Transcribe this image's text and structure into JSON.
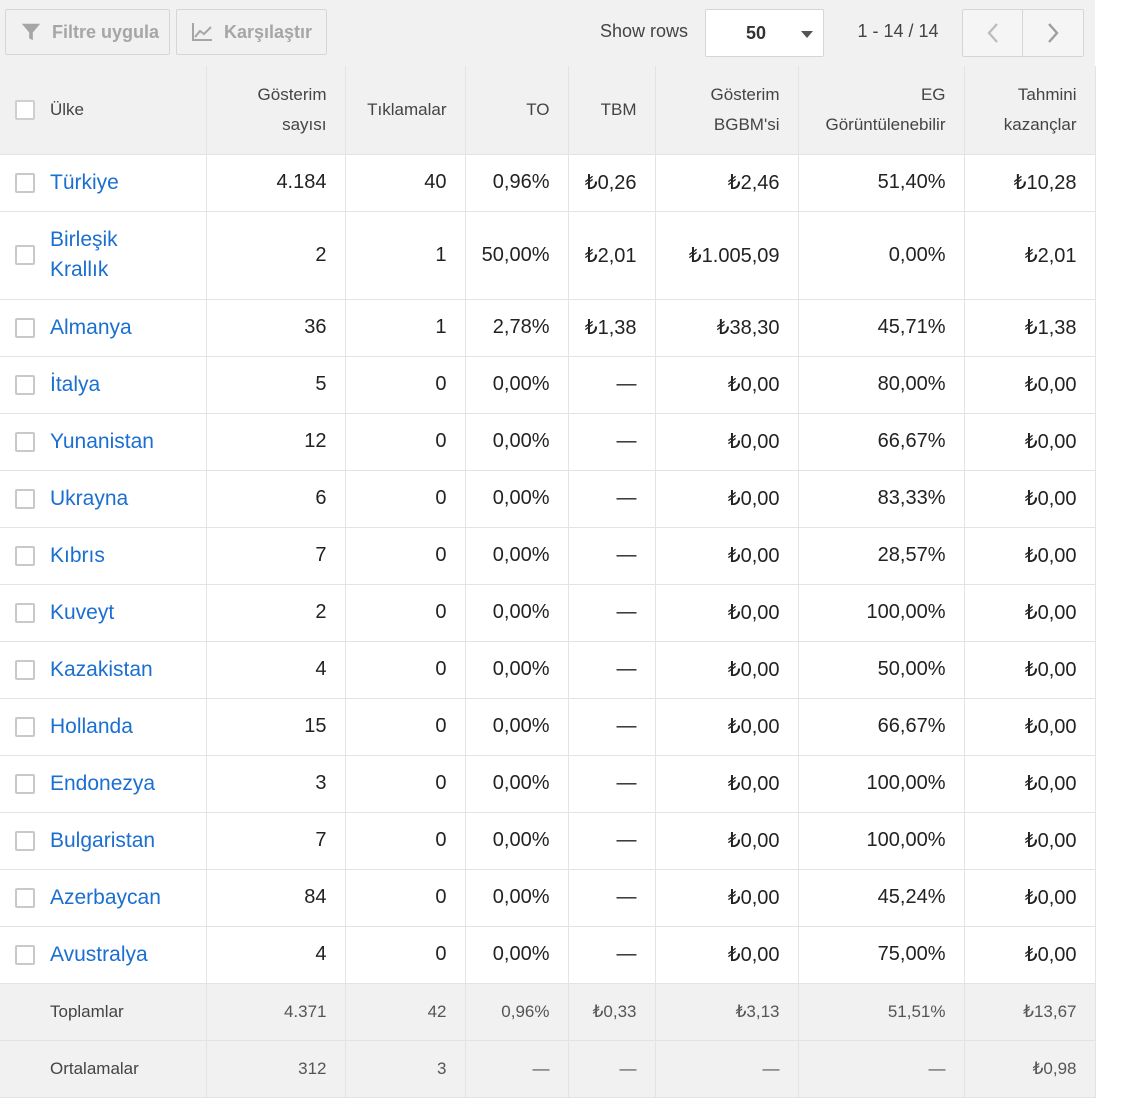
{
  "toolbar": {
    "filter_label": "Filtre uygula",
    "compare_label": "Karşılaştır",
    "show_rows_label": "Show rows",
    "rows_value": "50",
    "range_text": "1 - 14 / 14"
  },
  "columns": {
    "country": "Ülke",
    "impressions_1": "Gösterim",
    "impressions_2": "sayısı",
    "clicks": "Tıklamalar",
    "ctr": "TO",
    "cpc": "TBM",
    "rpm_1": "Gösterim",
    "rpm_2": "BGBM'si",
    "viewable_1": "EG",
    "viewable_2": "Görüntülenebilir",
    "earnings_1": "Tahmini",
    "earnings_2": "kazançlar"
  },
  "rows": [
    {
      "country": "Türkiye",
      "impressions": "4.184",
      "clicks": "40",
      "ctr": "0,96%",
      "cpc": "₺0,26",
      "rpm": "₺2,46",
      "viewable": "51,40%",
      "earnings": "₺10,28"
    },
    {
      "country_1": "Birleşik",
      "country_2": "Krallık",
      "impressions": "2",
      "clicks": "1",
      "ctr": "50,00%",
      "cpc": "₺2,01",
      "rpm": "₺1.005,09",
      "viewable": "0,00%",
      "earnings": "₺2,01"
    },
    {
      "country": "Almanya",
      "impressions": "36",
      "clicks": "1",
      "ctr": "2,78%",
      "cpc": "₺1,38",
      "rpm": "₺38,30",
      "viewable": "45,71%",
      "earnings": "₺1,38"
    },
    {
      "country": "İtalya",
      "impressions": "5",
      "clicks": "0",
      "ctr": "0,00%",
      "cpc": "—",
      "rpm": "₺0,00",
      "viewable": "80,00%",
      "earnings": "₺0,00"
    },
    {
      "country": "Yunanistan",
      "impressions": "12",
      "clicks": "0",
      "ctr": "0,00%",
      "cpc": "—",
      "rpm": "₺0,00",
      "viewable": "66,67%",
      "earnings": "₺0,00"
    },
    {
      "country": "Ukrayna",
      "impressions": "6",
      "clicks": "0",
      "ctr": "0,00%",
      "cpc": "—",
      "rpm": "₺0,00",
      "viewable": "83,33%",
      "earnings": "₺0,00"
    },
    {
      "country": "Kıbrıs",
      "impressions": "7",
      "clicks": "0",
      "ctr": "0,00%",
      "cpc": "—",
      "rpm": "₺0,00",
      "viewable": "28,57%",
      "earnings": "₺0,00"
    },
    {
      "country": "Kuveyt",
      "impressions": "2",
      "clicks": "0",
      "ctr": "0,00%",
      "cpc": "—",
      "rpm": "₺0,00",
      "viewable": "100,00%",
      "earnings": "₺0,00"
    },
    {
      "country": "Kazakistan",
      "impressions": "4",
      "clicks": "0",
      "ctr": "0,00%",
      "cpc": "—",
      "rpm": "₺0,00",
      "viewable": "50,00%",
      "earnings": "₺0,00"
    },
    {
      "country": "Hollanda",
      "impressions": "15",
      "clicks": "0",
      "ctr": "0,00%",
      "cpc": "—",
      "rpm": "₺0,00",
      "viewable": "66,67%",
      "earnings": "₺0,00"
    },
    {
      "country": "Endonezya",
      "impressions": "3",
      "clicks": "0",
      "ctr": "0,00%",
      "cpc": "—",
      "rpm": "₺0,00",
      "viewable": "100,00%",
      "earnings": "₺0,00"
    },
    {
      "country": "Bulgaristan",
      "impressions": "7",
      "clicks": "0",
      "ctr": "0,00%",
      "cpc": "—",
      "rpm": "₺0,00",
      "viewable": "100,00%",
      "earnings": "₺0,00"
    },
    {
      "country": "Azerbaycan",
      "impressions": "84",
      "clicks": "0",
      "ctr": "0,00%",
      "cpc": "—",
      "rpm": "₺0,00",
      "viewable": "45,24%",
      "earnings": "₺0,00"
    },
    {
      "country": "Avustralya",
      "impressions": "4",
      "clicks": "0",
      "ctr": "0,00%",
      "cpc": "—",
      "rpm": "₺0,00",
      "viewable": "75,00%",
      "earnings": "₺0,00"
    }
  ],
  "totals": {
    "label": "Toplamlar",
    "impressions": "4.371",
    "clicks": "42",
    "ctr": "0,96%",
    "cpc": "₺0,33",
    "rpm": "₺3,13",
    "viewable": "51,51%",
    "earnings": "₺13,67"
  },
  "averages": {
    "label": "Ortalamalar",
    "impressions": "312",
    "clicks": "3",
    "ctr": "—",
    "cpc": "—",
    "rpm": "—",
    "viewable": "—",
    "earnings": "₺0,98"
  },
  "icons": {
    "filter": "filter-icon",
    "compare": "line-chart-icon",
    "prev": "chevron-left-icon",
    "next": "chevron-right-icon",
    "dropdown": "caret-down-icon"
  },
  "colors": {
    "link": "#1a6fd1",
    "toolbar_bg": "#f1f1f1",
    "disabled_text": "#a6a6a6"
  }
}
